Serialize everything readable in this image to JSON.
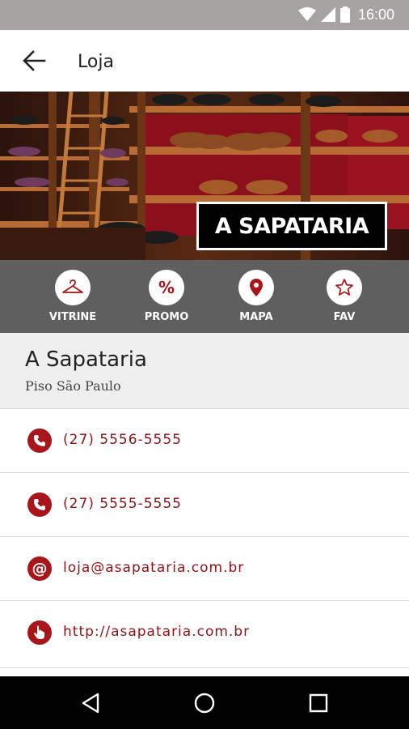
{
  "status_bar": {
    "time": "16:00",
    "icons": [
      "wifi-icon",
      "signal-icon",
      "battery-icon"
    ]
  },
  "app_bar": {
    "title": "Loja",
    "back_icon": "arrow-back-icon"
  },
  "hero": {
    "brand_text": "A SAPATARIA"
  },
  "actions": [
    {
      "label": "VITRINE",
      "icon": "hanger-icon"
    },
    {
      "label": "PROMO",
      "icon": "percent-icon"
    },
    {
      "label": "MAPA",
      "icon": "map-pin-icon"
    },
    {
      "label": "FAV",
      "icon": "star-icon"
    }
  ],
  "store": {
    "name": "A Sapataria",
    "location": "Piso São Paulo"
  },
  "contacts": [
    {
      "type": "phone",
      "text": "(27) 5556-5555",
      "icon": "phone-icon"
    },
    {
      "type": "phone",
      "text": "(27) 5555-5555",
      "icon": "phone-icon"
    },
    {
      "type": "email",
      "text": "loja@asapataria.com.br",
      "icon": "at-icon"
    },
    {
      "type": "web",
      "text": "http://asapataria.com.br",
      "icon": "pointer-icon"
    }
  ],
  "colors": {
    "accent": "#a8161c",
    "accent_text": "#8e1318",
    "action_bar": "#605f60",
    "status_bar": "#a7a3a3",
    "header_bg": "#efefef"
  },
  "nav_bar": {
    "buttons": [
      "back-triangle-icon",
      "home-circle-icon",
      "recents-square-icon"
    ]
  }
}
